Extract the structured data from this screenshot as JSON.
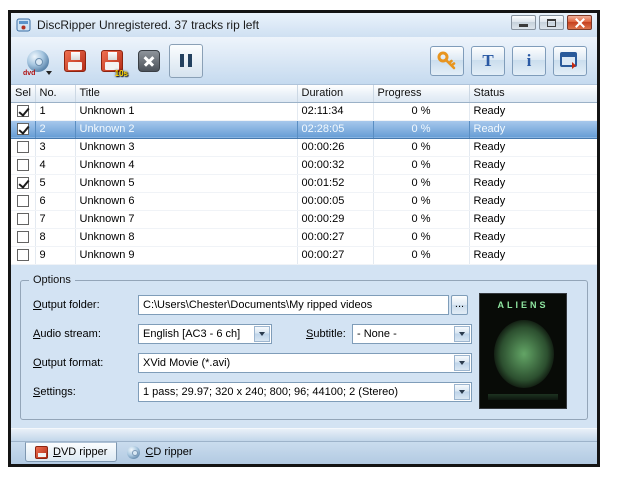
{
  "window": {
    "title": "DiscRipper Unregistered. 37 tracks rip left"
  },
  "toolbar": {
    "dvd_label": "dvd",
    "rip10_badge": "10s",
    "text_button_glyph": "T",
    "info_button_glyph": "i"
  },
  "table": {
    "columns": [
      "Sel",
      "No.",
      "Title",
      "Duration",
      "Progress",
      "Status"
    ],
    "rows": [
      {
        "sel": true,
        "no": "1",
        "title": "Unknown 1",
        "duration": "02:11:34",
        "progress": "0 %",
        "status": "Ready",
        "selected": false
      },
      {
        "sel": true,
        "no": "2",
        "title": "Unknown 2",
        "duration": "02:28:05",
        "progress": "0 %",
        "status": "Ready",
        "selected": true
      },
      {
        "sel": false,
        "no": "3",
        "title": "Unknown 3",
        "duration": "00:00:26",
        "progress": "0 %",
        "status": "Ready",
        "selected": false
      },
      {
        "sel": false,
        "no": "4",
        "title": "Unknown 4",
        "duration": "00:00:32",
        "progress": "0 %",
        "status": "Ready",
        "selected": false
      },
      {
        "sel": true,
        "no": "5",
        "title": "Unknown 5",
        "duration": "00:01:52",
        "progress": "0 %",
        "status": "Ready",
        "selected": false
      },
      {
        "sel": false,
        "no": "6",
        "title": "Unknown 6",
        "duration": "00:00:05",
        "progress": "0 %",
        "status": "Ready",
        "selected": false
      },
      {
        "sel": false,
        "no": "7",
        "title": "Unknown 7",
        "duration": "00:00:29",
        "progress": "0 %",
        "status": "Ready",
        "selected": false
      },
      {
        "sel": false,
        "no": "8",
        "title": "Unknown 8",
        "duration": "00:00:27",
        "progress": "0 %",
        "status": "Ready",
        "selected": false
      },
      {
        "sel": false,
        "no": "9",
        "title": "Unknown 9",
        "duration": "00:00:27",
        "progress": "0 %",
        "status": "Ready",
        "selected": false
      }
    ]
  },
  "options": {
    "group_label": "Options",
    "output_folder_label": "Output folder:",
    "output_folder_value": "C:\\Users\\Chester\\Documents\\My ripped videos",
    "browse_label": "...",
    "audio_stream_label": "Audio stream:",
    "audio_stream_value": "English [AC3 - 6 ch]",
    "subtitle_label": "Subtitle:",
    "subtitle_value": "- None -",
    "output_format_label": "Output format:",
    "output_format_value": "XVid Movie (*.avi)",
    "settings_label": "Settings:",
    "settings_value": "1 pass; 29.97; 320 x 240; 800; 96; 44100; 2 (Stereo)"
  },
  "poster": {
    "title": "ALIENS"
  },
  "tabs": [
    {
      "label": "DVD ripper",
      "active": true
    },
    {
      "label": "CD ripper",
      "active": false
    }
  ],
  "colors": {
    "selection_blue": "#669dd5",
    "titlebar_blue": "#d9e7f6",
    "close_button_red": "#c6401f",
    "floppy_red": "#b52c18",
    "key_orange": "#e8951f"
  }
}
